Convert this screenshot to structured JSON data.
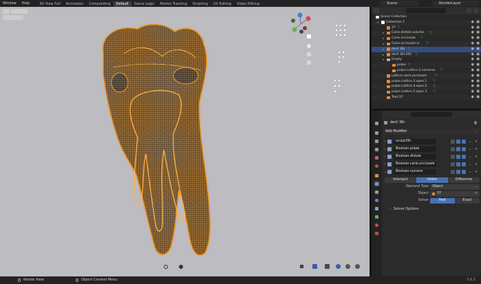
{
  "menu": [
    "Window",
    "Help"
  ],
  "workspaces": [
    {
      "label": "3D View Full",
      "active": false
    },
    {
      "label": "Animation",
      "active": false
    },
    {
      "label": "Compositing",
      "active": false
    },
    {
      "label": "Default",
      "active": true
    },
    {
      "label": "Game Logic",
      "active": false
    },
    {
      "label": "Motion Tracking",
      "active": false
    },
    {
      "label": "Scripting",
      "active": false
    },
    {
      "label": "UV Editing",
      "active": false
    },
    {
      "label": "Video Editing",
      "active": false
    }
  ],
  "scene": "Scene",
  "render_layer": "RenderLayer",
  "outliner": {
    "rows": [
      {
        "label": "Scene Collection",
        "indent": 0,
        "tri": "",
        "icon": "collection-icon",
        "color": "#ffffff",
        "selected": false,
        "mods": false
      },
      {
        "label": "Collection 1",
        "indent": 1,
        "tri": "▾",
        "icon": "collection-icon",
        "color": "#ffffff",
        "selected": false,
        "mods": false
      },
      {
        "label": "37",
        "indent": 2,
        "tri": "",
        "icon": "mesh-icon",
        "color": "#e58a35",
        "selected": false,
        "mods": true
      },
      {
        "label": "Carie.distale.volume",
        "indent": 2,
        "tri": "▸",
        "icon": "mesh-icon",
        "color": "#e58a35",
        "selected": false,
        "mods": true
      },
      {
        "label": "Carie.occlusale",
        "indent": 2,
        "tri": "▸",
        "icon": "mesh-icon",
        "color": "#e58a35",
        "selected": false,
        "mods": true
      },
      {
        "label": "Carie.occlusale.vi",
        "indent": 2,
        "tri": "▸",
        "icon": "mesh-icon",
        "color": "#e58a35",
        "selected": false,
        "mods": true
      },
      {
        "label": "dent 36r",
        "indent": 2,
        "tri": "▸",
        "icon": "mesh-icon",
        "color": "#e58a35",
        "selected": true,
        "mods": true
      },
      {
        "label": "dent 36r.001",
        "indent": 2,
        "tri": "▸",
        "icon": "mesh-icon",
        "color": "#e58a35",
        "selected": false,
        "mods": true
      },
      {
        "label": "Empty",
        "indent": 2,
        "tri": "▾",
        "icon": "empty-icon",
        "color": "#b0b0b0",
        "selected": false,
        "mods": false
      },
      {
        "label": "pulpe",
        "indent": 3,
        "tri": "",
        "icon": "mesh-icon",
        "color": "#e58a35",
        "selected": false,
        "mods": true
      },
      {
        "label": "pulpe.Lattice.2.cameras",
        "indent": 3,
        "tri": "",
        "icon": "lattice-icon",
        "color": "#e58a35",
        "selected": false,
        "mods": true
      },
      {
        "label": "Lattice.carie.occlusale",
        "indent": 2,
        "tri": "",
        "icon": "lattice-icon",
        "color": "#e58a35",
        "selected": false,
        "mods": true
      },
      {
        "label": "pulpe.Lattice.3.apex.1",
        "indent": 2,
        "tri": "",
        "icon": "lattice-icon",
        "color": "#e58a35",
        "selected": false,
        "mods": true
      },
      {
        "label": "pulpe.Lattice.4.apex.2",
        "indent": 2,
        "tri": "",
        "icon": "lattice-icon",
        "color": "#e58a35",
        "selected": false,
        "mods": true
      },
      {
        "label": "pulpe.Lattice.5.apex.3",
        "indent": 2,
        "tri": "",
        "icon": "lattice-icon",
        "color": "#e58a35",
        "selected": false,
        "mods": true
      },
      {
        "label": "Text.37",
        "indent": 2,
        "tri": "",
        "icon": "text-icon",
        "color": "#e58a35",
        "selected": false,
        "mods": false
      }
    ]
  },
  "properties": {
    "object_name": "dent 36r",
    "add_modifier": "Add Modifier",
    "modifiers": [
      "sculpt36r",
      "Boolean.pulpe",
      "Boolean.distale",
      "Boolean.carie.occlusale",
      "Boolean.numero"
    ],
    "operations": [
      {
        "label": "Intersect",
        "active": false
      },
      {
        "label": "Union",
        "active": true
      },
      {
        "label": "Difference",
        "active": false
      }
    ],
    "operand_type_label": "Operand Type",
    "operand_type_value": "Object",
    "object_label": "Object",
    "object_value": "37",
    "solver_label": "Solver",
    "solvers": [
      {
        "label": "Fast",
        "active": true
      },
      {
        "label": "Exact",
        "active": false
      }
    ],
    "solver_options": "Solver Options"
  },
  "status": {
    "left": "Rotate View",
    "middle": "Object Context Menu",
    "version": "3.6.0"
  },
  "colors": {
    "wire": "#f2901a",
    "wire_fill": "#3e3c3a",
    "viewport_bg": "#bcbcc1",
    "selection": "#334d80",
    "accent": "#4772b3"
  }
}
